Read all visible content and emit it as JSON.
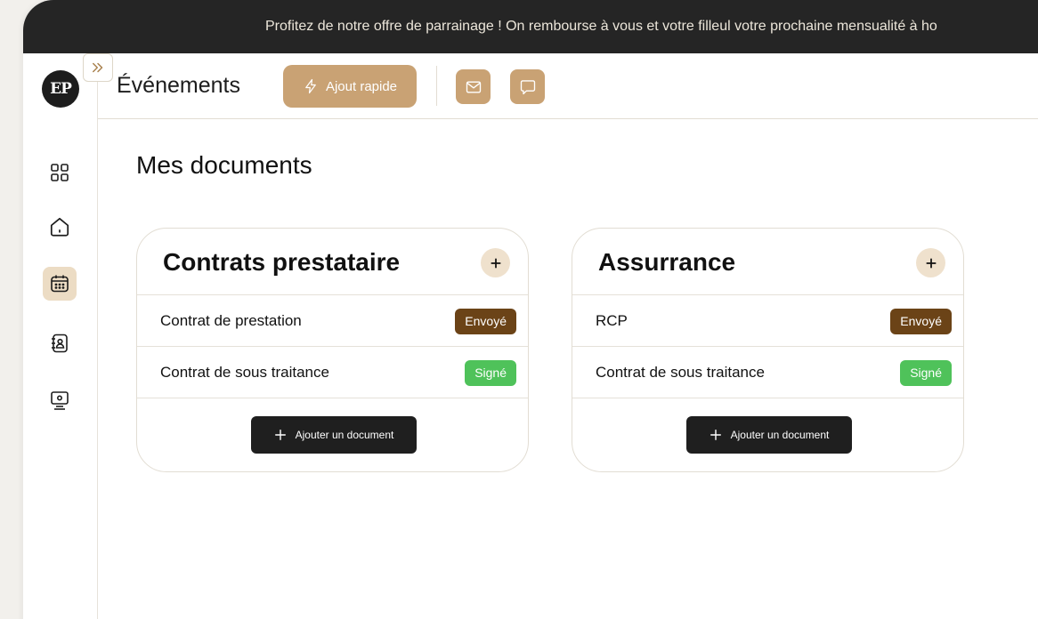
{
  "banner": {
    "text": "Profitez de notre offre de parrainage ! On rembourse à vous et votre filleul votre prochaine mensualité à ho"
  },
  "sidebar": {
    "logo_text": "EP",
    "items": [
      {
        "name": "dashboard",
        "icon": "grid-icon",
        "active": false
      },
      {
        "name": "home",
        "icon": "home-icon",
        "active": false
      },
      {
        "name": "events",
        "icon": "calendar-icon",
        "active": true
      },
      {
        "name": "contacts",
        "icon": "contact-book-icon",
        "active": false
      },
      {
        "name": "presentation",
        "icon": "monitor-icon",
        "active": false
      }
    ]
  },
  "topbar": {
    "title": "Événements",
    "quick_add_label": "Ajout rapide"
  },
  "main": {
    "section_title": "Mes documents",
    "cards": [
      {
        "title": "Contrats prestataire",
        "rows": [
          {
            "label": "Contrat de prestation",
            "status": "Envoyé"
          },
          {
            "label": "Contrat de sous traitance",
            "status": "Signé"
          }
        ],
        "add_label": "Ajouter un document"
      },
      {
        "title": "Assurrance",
        "rows": [
          {
            "label": "RCP",
            "status": "Envoyé"
          },
          {
            "label": "Contrat de sous traitance",
            "status": "Signé"
          }
        ],
        "add_label": "Ajouter un document"
      }
    ]
  },
  "colors": {
    "accent": "#c9a274",
    "banner_bg": "#252525",
    "status_sent": "#6b4317",
    "status_signed": "#4fc25a",
    "active_nav": "#ecdcc4"
  }
}
